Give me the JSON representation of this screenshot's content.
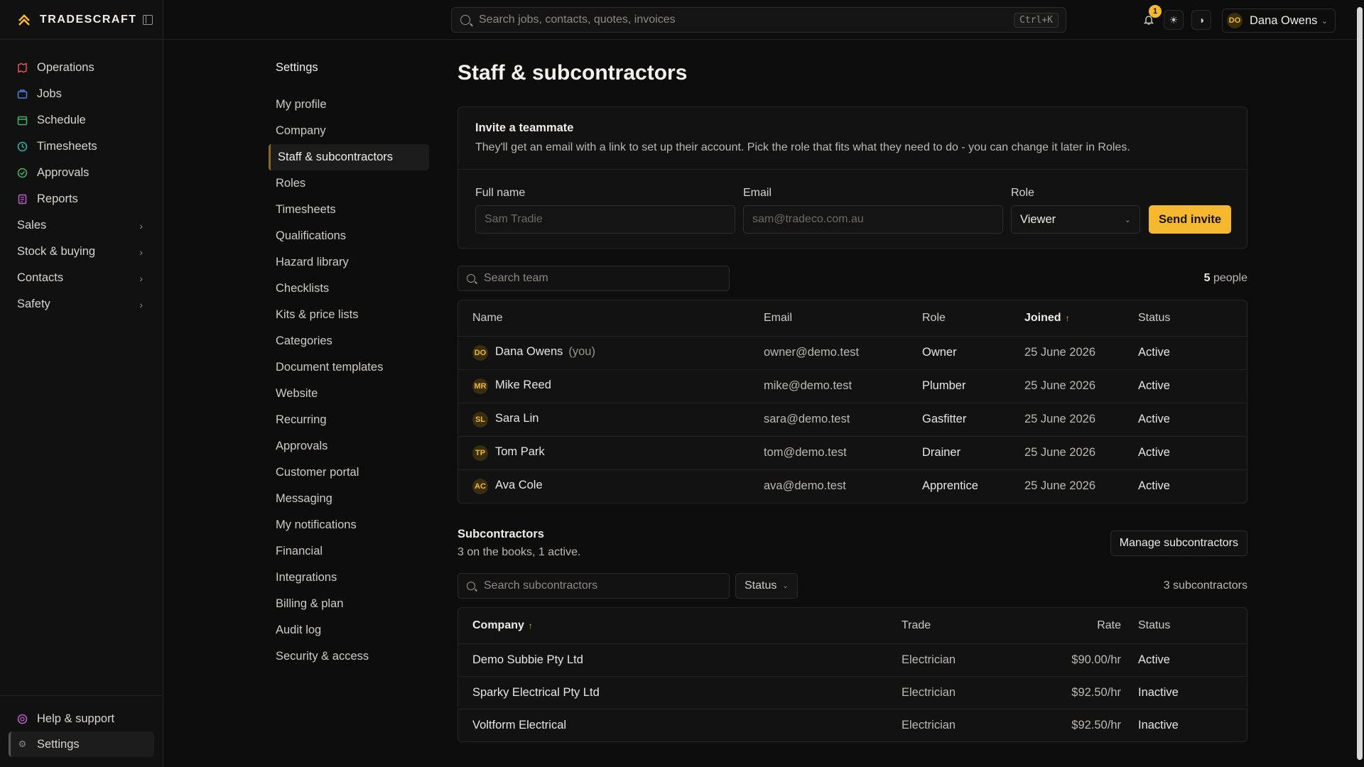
{
  "brand": {
    "name": "TRADESCRAFT"
  },
  "sidebar": {
    "items": [
      {
        "label": "Operations",
        "color": "#e05252"
      },
      {
        "label": "Jobs",
        "color": "#4f7fe0"
      },
      {
        "label": "Schedule",
        "color": "#3fb36b"
      },
      {
        "label": "Timesheets",
        "color": "#2fb5b5"
      },
      {
        "label": "Approvals",
        "color": "#3fb36b"
      },
      {
        "label": "Reports",
        "color": "#c05bd0"
      }
    ],
    "groups": [
      "Sales",
      "Stock & buying",
      "Contacts",
      "Safety"
    ],
    "footer": {
      "help": "Help & support",
      "settings": "Settings"
    }
  },
  "header": {
    "search_placeholder": "Search jobs, contacts, quotes, invoices",
    "shortcut": "Ctrl+K",
    "notifications": "1",
    "user": {
      "initials": "DO",
      "name": "Dana Owens"
    }
  },
  "settings_nav": {
    "title": "Settings",
    "items": [
      "My profile",
      "Company",
      "Staff & subcontractors",
      "Roles",
      "Timesheets",
      "Qualifications",
      "Hazard library",
      "Checklists",
      "Kits & price lists",
      "Categories",
      "Document templates",
      "Website",
      "Recurring",
      "Approvals",
      "Customer portal",
      "Messaging",
      "My notifications",
      "Financial",
      "Integrations",
      "Billing & plan",
      "Audit log",
      "Security & access"
    ],
    "active": "Staff & subcontractors"
  },
  "page": {
    "title": "Staff & subcontractors"
  },
  "invite": {
    "title": "Invite a teammate",
    "description": "They'll get an email with a link to set up their account. Pick the role that fits what they need to do - you can change it later in Roles.",
    "full_name_label": "Full name",
    "full_name_placeholder": "Sam Tradie",
    "email_label": "Email",
    "email_placeholder": "sam@tradeco.com.au",
    "role_label": "Role",
    "role_value": "Viewer",
    "send_label": "Send invite"
  },
  "team": {
    "search_placeholder": "Search team",
    "count": "5",
    "count_suffix": "people",
    "columns": {
      "name": "Name",
      "email": "Email",
      "role": "Role",
      "joined": "Joined",
      "status": "Status"
    },
    "rows": [
      {
        "initials": "DO",
        "name": "Dana Owens",
        "you": "(you)",
        "email": "owner@demo.test",
        "role": "Owner",
        "joined": "25 June 2026",
        "status": "Active"
      },
      {
        "initials": "MR",
        "name": "Mike Reed",
        "you": "",
        "email": "mike@demo.test",
        "role": "Plumber",
        "joined": "25 June 2026",
        "status": "Active"
      },
      {
        "initials": "SL",
        "name": "Sara Lin",
        "you": "",
        "email": "sara@demo.test",
        "role": "Gasfitter",
        "joined": "25 June 2026",
        "status": "Active"
      },
      {
        "initials": "TP",
        "name": "Tom Park",
        "you": "",
        "email": "tom@demo.test",
        "role": "Drainer",
        "joined": "25 June 2026",
        "status": "Active"
      },
      {
        "initials": "AC",
        "name": "Ava Cole",
        "you": "",
        "email": "ava@demo.test",
        "role": "Apprentice",
        "joined": "25 June 2026",
        "status": "Active"
      }
    ]
  },
  "subcontractors": {
    "title": "Subcontractors",
    "summary": "3 on the books, 1 active.",
    "manage_label": "Manage subcontractors",
    "search_placeholder": "Search subcontractors",
    "status_filter": "Status",
    "count": "3 subcontractors",
    "columns": {
      "company": "Company",
      "trade": "Trade",
      "rate": "Rate",
      "status": "Status"
    },
    "rows": [
      {
        "company": "Demo Subbie Pty Ltd",
        "trade": "Electrician",
        "rate": "$90.00/hr",
        "status": "Active"
      },
      {
        "company": "Sparky Electrical Pty Ltd",
        "trade": "Electrician",
        "rate": "$92.50/hr",
        "status": "Inactive"
      },
      {
        "company": "Voltform Electrical",
        "trade": "Electrician",
        "rate": "$92.50/hr",
        "status": "Inactive"
      }
    ]
  }
}
